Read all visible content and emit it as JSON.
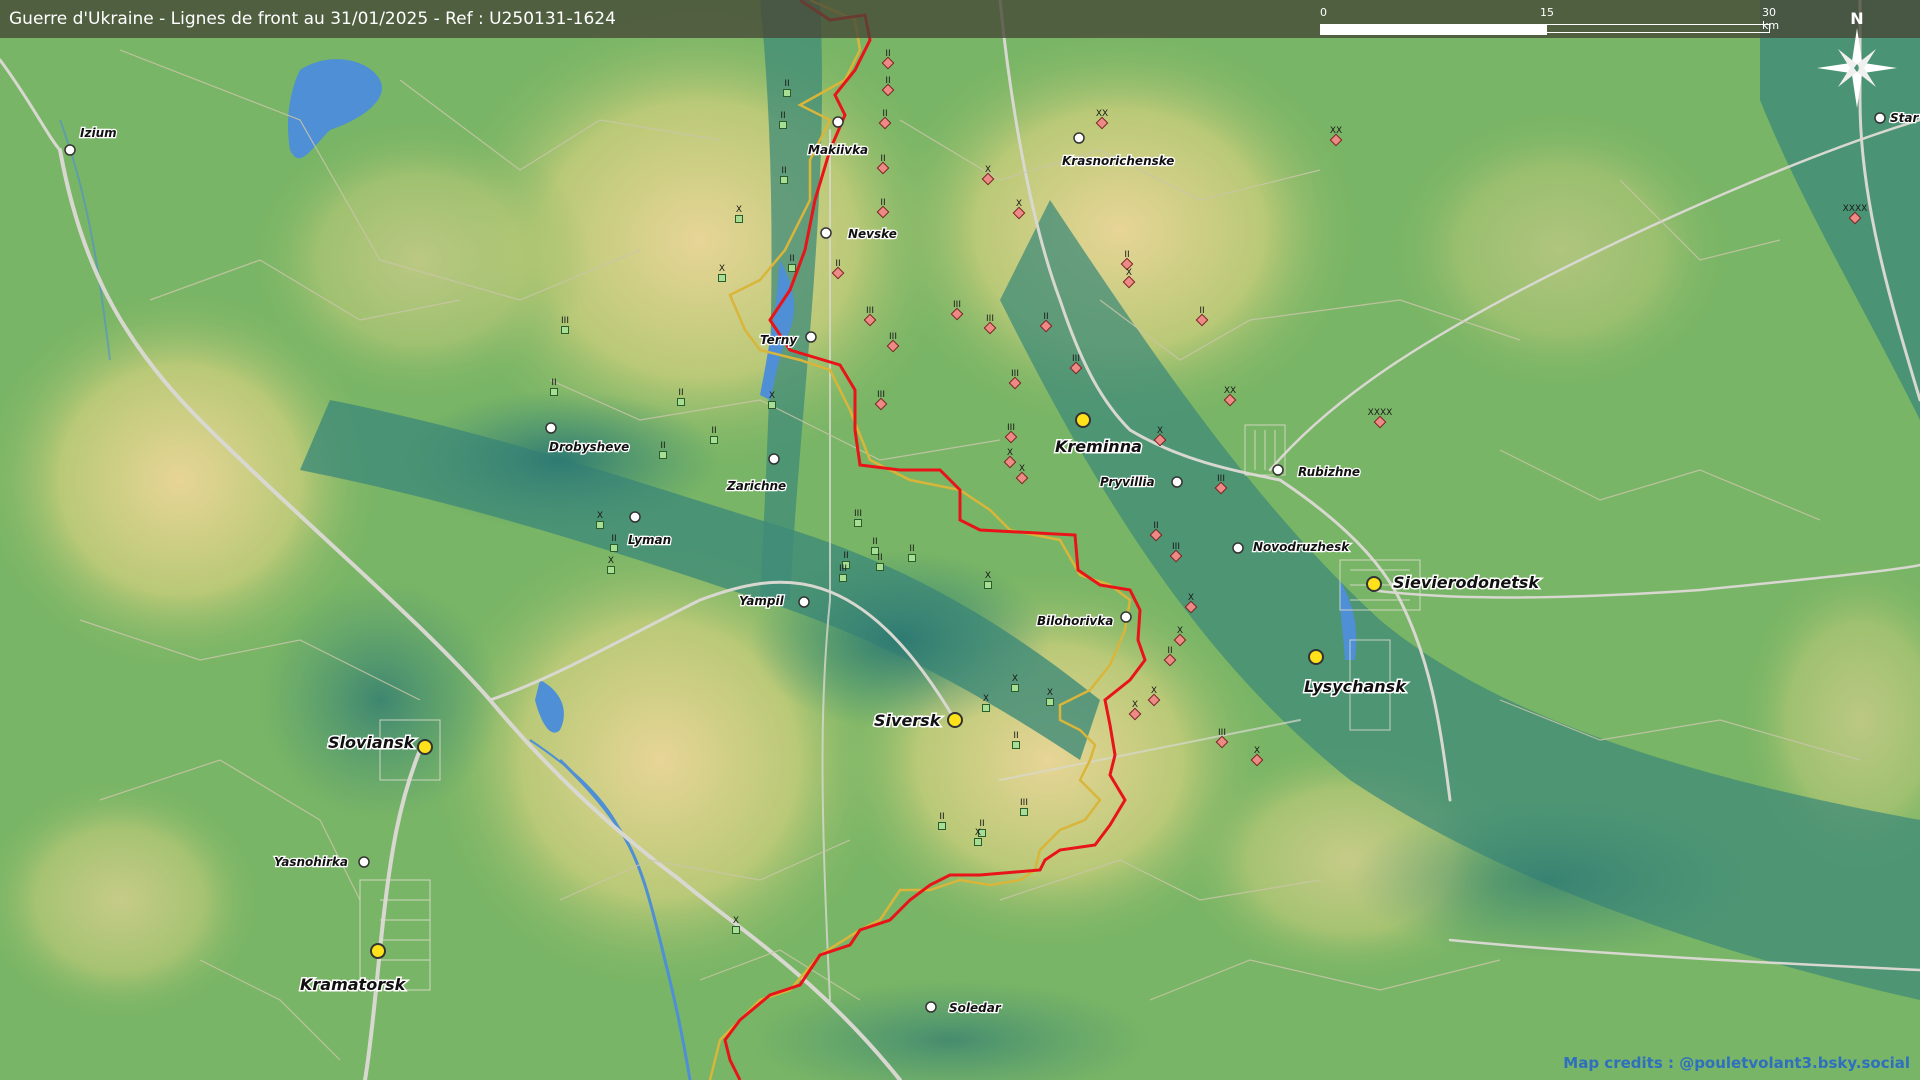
{
  "title": "Guerre d'Ukraine - Lignes de front au 31/01/2025 - Ref : U250131-1624",
  "scale": {
    "ticks": [
      "0",
      "15",
      "30 km"
    ]
  },
  "compass": {
    "label": "N"
  },
  "credits": "Map credits : @pouletvolant3.bsky.social",
  "colors": {
    "front_line": "#e8141a",
    "grey_zone_line": "#d9b53a",
    "terrain_low": "#3f8b78",
    "terrain_mid": "#8cc063",
    "terrain_high": "#e4d38f",
    "water": "#4e8fd6"
  },
  "cities": [
    {
      "name": "Izium",
      "major": false
    },
    {
      "name": "Makiivka",
      "major": false
    },
    {
      "name": "Nevske",
      "major": false
    },
    {
      "name": "Terny",
      "major": false
    },
    {
      "name": "Krasnorichenske",
      "major": false
    },
    {
      "name": "Star",
      "major": false
    },
    {
      "name": "Kreminna",
      "major": true
    },
    {
      "name": "Drobysheve",
      "major": false
    },
    {
      "name": "Zarichne",
      "major": false
    },
    {
      "name": "Lyman",
      "major": false
    },
    {
      "name": "Pryvillia",
      "major": false
    },
    {
      "name": "Rubizhne",
      "major": false
    },
    {
      "name": "Novodruzhesk",
      "major": false
    },
    {
      "name": "Sievierodonetsk",
      "major": true
    },
    {
      "name": "Yampil",
      "major": false
    },
    {
      "name": "Bilohorivka",
      "major": false
    },
    {
      "name": "Lysychansk",
      "major": true
    },
    {
      "name": "Siversk",
      "major": true
    },
    {
      "name": "Sloviansk",
      "major": true
    },
    {
      "name": "Yasnohirka",
      "major": false
    },
    {
      "name": "Kramatorsk",
      "major": true
    },
    {
      "name": "Soledar",
      "major": false
    }
  ],
  "unit_markers": {
    "ukrainian": [
      "II",
      "II",
      "II",
      "X",
      "X",
      "II",
      "III",
      "II",
      "II",
      "II",
      "X",
      "II",
      "X",
      "X",
      "II",
      "III",
      "II",
      "II",
      "II",
      "II",
      "III",
      "X",
      "X",
      "X",
      "II",
      "X",
      "III",
      "II",
      "II",
      "X",
      "X"
    ],
    "russian": [
      "II",
      "II",
      "II",
      "II",
      "II",
      "II",
      "X",
      "X",
      "XX",
      "II",
      "III",
      "III",
      "III",
      "III",
      "III",
      "XX",
      "X",
      "II",
      "III",
      "II",
      "XX",
      "X",
      "III",
      "III",
      "XXXX",
      "XXXX",
      "X",
      "X",
      "III",
      "II",
      "III",
      "X",
      "X",
      "II",
      "X",
      "X",
      "III",
      "X"
    ]
  }
}
